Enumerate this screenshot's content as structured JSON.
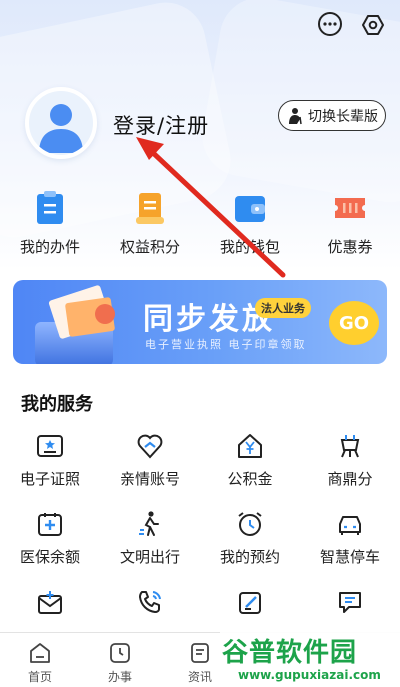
{
  "header": {
    "login_label": "登录/注册",
    "elder_mode_label": "切换长辈版",
    "icons": [
      "more-icon",
      "settings-icon"
    ]
  },
  "quick_actions": [
    {
      "label": "我的办件",
      "icon": "clipboard-icon",
      "color": "#2f8cf0"
    },
    {
      "label": "权益积分",
      "icon": "scroll-icon",
      "color": "#f6a32b"
    },
    {
      "label": "我的钱包",
      "icon": "wallet-icon",
      "color": "#2f8cf0"
    },
    {
      "label": "优惠券",
      "icon": "coupon-icon",
      "color": "#f36b4f"
    }
  ],
  "banner": {
    "title": "同步发放",
    "tag": "法人业务",
    "subtitle": "电子营业执照  电子印章领取",
    "go_label": "GO"
  },
  "services": {
    "title": "我的服务",
    "items": [
      {
        "label": "电子证照",
        "icon": "id-card-icon"
      },
      {
        "label": "亲情账号",
        "icon": "heart-link-icon"
      },
      {
        "label": "公积金",
        "icon": "house-yen-icon"
      },
      {
        "label": "商鼎分",
        "icon": "tripod-icon"
      },
      {
        "label": "医保余额",
        "icon": "medical-card-icon"
      },
      {
        "label": "文明出行",
        "icon": "pedestrian-icon"
      },
      {
        "label": "我的预约",
        "icon": "alarm-clock-icon"
      },
      {
        "label": "智慧停车",
        "icon": "car-icon"
      },
      {
        "label": "",
        "icon": "mail-icon"
      },
      {
        "label": "",
        "icon": "phone-icon"
      },
      {
        "label": "",
        "icon": "edit-icon"
      },
      {
        "label": "",
        "icon": "message-icon"
      }
    ]
  },
  "tabbar": {
    "tabs": [
      {
        "label": "首页",
        "icon": "home-tab-icon"
      },
      {
        "label": "办事",
        "icon": "clock-tab-icon"
      },
      {
        "label": "资讯",
        "icon": "news-tab-icon"
      }
    ]
  },
  "watermark": {
    "title": "谷普软件园",
    "url": "www.gupuxiazai.com"
  },
  "colors": {
    "accent_blue": "#2f8cf0",
    "annotation_red": "#e02a1f",
    "watermark_green": "#1da34a"
  }
}
